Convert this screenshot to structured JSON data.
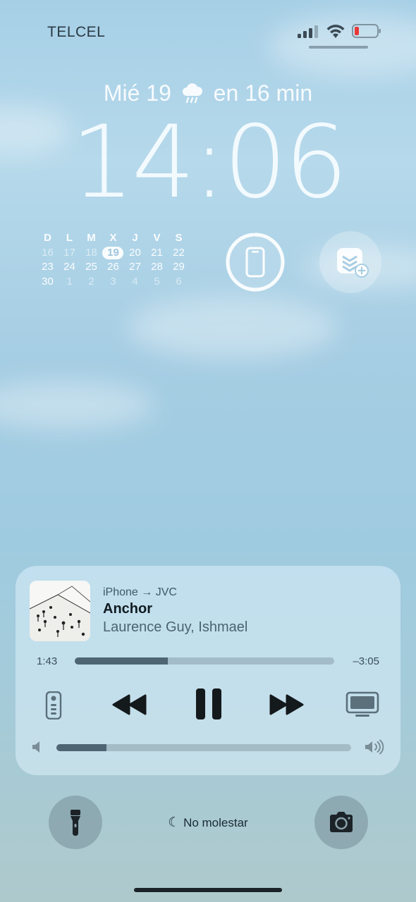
{
  "status_bar": {
    "carrier": "TELCEL",
    "signal_bars": 3,
    "battery_level": "low"
  },
  "lock_screen": {
    "date": "Mié 19",
    "weather_text": "en 16 min",
    "weather_icon": "rain-cloud-icon",
    "time": "14:06"
  },
  "calendar": {
    "headers": [
      "D",
      "L",
      "M",
      "X",
      "J",
      "V",
      "S"
    ],
    "rows": [
      [
        "16",
        "17",
        "18",
        "19",
        "20",
        "21",
        "22"
      ],
      [
        "23",
        "24",
        "25",
        "26",
        "27",
        "28",
        "29"
      ],
      [
        "30",
        "1",
        "2",
        "3",
        "4",
        "5",
        "6"
      ]
    ],
    "today": "19"
  },
  "widgets": {
    "device_battery_icon": "iphone-icon",
    "add_widget_icon": "stack-add-icon"
  },
  "now_playing": {
    "route": "iPhone → JVC",
    "title": "Anchor",
    "artist": "Laurence Guy, Ishmael",
    "elapsed": "1:43",
    "remaining": "–3:05",
    "progress_fraction": 0.36,
    "volume_fraction": 0.17
  },
  "bottom": {
    "focus_label": "No molestar",
    "flashlight_icon": "flashlight-icon",
    "camera_icon": "camera-icon"
  }
}
